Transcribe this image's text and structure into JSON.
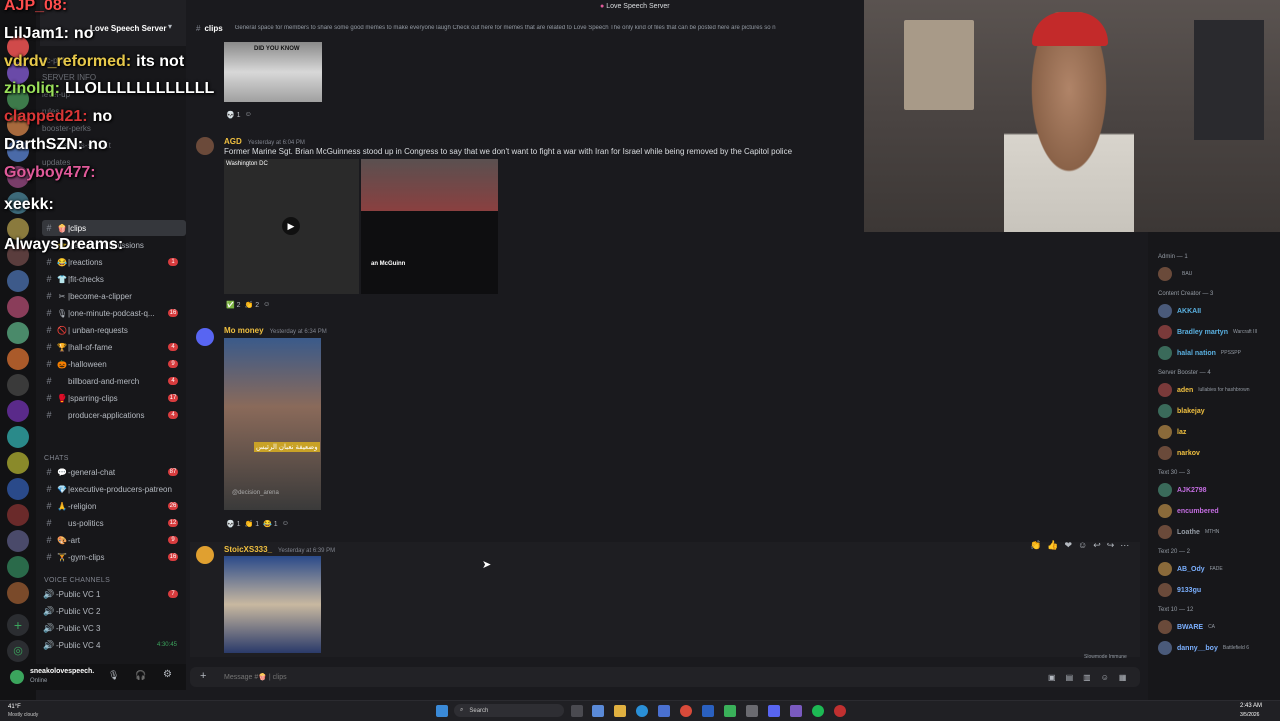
{
  "server": {
    "name": "Love Speech Server",
    "window_title": "Love Speech Server"
  },
  "channel": {
    "name": "clips",
    "topic": "General space for members to share some good memes to make everyone laugh Check out here for memes that are related to Love Speech The only kind of files that can be posted here are pictures so n"
  },
  "overlay_chat": [
    {
      "user": "AJP_08:",
      "msg": "",
      "color": "#ff4d4d"
    },
    {
      "user": "LilJam1:",
      "msg": "no",
      "color": "#ffffff"
    },
    {
      "user": "vdrdv_reformed:",
      "msg": "its not",
      "color": "#e6c84a"
    },
    {
      "user": "zinoliq:",
      "msg": "LLOLLLLLLLLLLLL",
      "color": "#9ae05a"
    },
    {
      "user": "clapped21:",
      "msg": "no",
      "color": "#d93636"
    },
    {
      "user": "DarthSZN:",
      "msg": "no",
      "color": "#ffffff"
    },
    {
      "user": "Goyboy477:",
      "msg": "",
      "color": "#e05a9a"
    },
    {
      "user": "xeekk:",
      "msg": "",
      "color": "#ffffff"
    },
    {
      "user": "AlwaysDreams:",
      "msg": "",
      "color": "#ffffff"
    }
  ],
  "sidebar_partial": [
    "pc-pdf",
    "SERVER INFO",
    "level-up",
    "rules",
    "booster-perks",
    "suggestions-submit",
    "updates"
  ],
  "channels": [
    {
      "name": "|clips",
      "emoji": "🍿",
      "badge": "",
      "active": true
    },
    {
      "name": "|patreon-submissions",
      "emoji": "⭐",
      "badge": "",
      "active": false
    },
    {
      "name": "|reactions",
      "emoji": "😂",
      "badge": "1",
      "active": false
    },
    {
      "name": "|fit-checks",
      "emoji": "👕",
      "badge": "",
      "active": false
    },
    {
      "name": "|become-a-clipper",
      "emoji": "✂",
      "badge": "",
      "active": false
    },
    {
      "name": "|one-minute-podcast-q...",
      "emoji": "🎙",
      "badge": "16",
      "active": false
    },
    {
      "name": "| unban-requests",
      "emoji": "🚫",
      "badge": "",
      "active": false
    },
    {
      "name": "|hall-of-fame",
      "emoji": "🏆",
      "badge": "4",
      "active": false
    },
    {
      "name": "-halloween",
      "emoji": "🎃",
      "badge": "9",
      "active": false
    },
    {
      "name": "billboard-and-merch",
      "emoji": "",
      "badge": "4",
      "active": false
    },
    {
      "name": "|sparring-clips",
      "emoji": "🥊",
      "badge": "17",
      "active": false
    },
    {
      "name": "producer-applications",
      "emoji": "",
      "badge": "4",
      "active": false
    }
  ],
  "chats_category": "CHATS",
  "chat_channels": [
    {
      "name": "-general-chat",
      "emoji": "💬",
      "badge": "87"
    },
    {
      "name": "|executive-producers-patreon",
      "emoji": "💎",
      "badge": ""
    },
    {
      "name": "-religion",
      "emoji": "🙏",
      "badge": "26"
    },
    {
      "name": "us-politics",
      "emoji": "",
      "badge": "12"
    },
    {
      "name": "-art",
      "emoji": "🎨",
      "badge": "9"
    },
    {
      "name": "-gym-clips",
      "emoji": "🏋",
      "badge": "16"
    }
  ],
  "voice_category": "VOICE CHANNELS",
  "voice_channels": [
    {
      "name": "-Public VC 1",
      "badge": "7"
    },
    {
      "name": "-Public VC 2",
      "badge": ""
    },
    {
      "name": "-Public VC 3",
      "badge": ""
    },
    {
      "name": "-Public VC 4",
      "badge": "4:30:45"
    }
  ],
  "user_panel": {
    "name": "sneakolovespeech.",
    "status": "Online"
  },
  "messages": [
    {
      "author": "AGD",
      "time": "Yesterday at 6:04 PM",
      "text": "Former Marine Sgt. Brian McGuinness stood up in Congress to say that we don't want to fight a war with Iran for Israel while being removed by the Capitol police",
      "location": "Washington DC",
      "card_name": "an McGuinn",
      "reactions": [
        "✅ 2",
        "👏 2"
      ]
    },
    {
      "author": "Mo money",
      "time": "Yesterday at 6:34 PM",
      "text": "",
      "caption": "وضعيفة نعبان الرئيس",
      "video_tag": "@decision_arena",
      "reactions": [
        "💀 1",
        "👏 1",
        "😂 1"
      ]
    },
    {
      "author": "StoicXS333_",
      "time": "Yesterday at 6:39 PM",
      "text": "",
      "reactions": []
    }
  ],
  "first_msg": {
    "caption": "DID YOU KNOW",
    "reactions": [
      "💀 1"
    ]
  },
  "composer": {
    "placeholder": "Message #🍿 | clips",
    "slowmode": "Slowmode Immune"
  },
  "members": {
    "groups": [
      {
        "role": "Admin — 1",
        "users": [
          {
            "name": "",
            "tag": "BAU",
            "color": "#dbdee1"
          }
        ]
      },
      {
        "role": "Content Creator — 3",
        "users": [
          {
            "name": "AKKAII",
            "tag": "",
            "color": "#5ab0e0"
          },
          {
            "name": "Bradley martyn",
            "tag": "Warcraft III",
            "color": "#5ab0e0"
          },
          {
            "name": "halal nation",
            "tag": "PPSSPP",
            "color": "#5ab0e0"
          }
        ]
      },
      {
        "role": "Server Booster — 4",
        "users": [
          {
            "name": "aden",
            "tag": "lullabies for hashbrown",
            "color": "#f0c040"
          },
          {
            "name": "blakejay",
            "tag": "",
            "color": "#f0c040"
          },
          {
            "name": "laz",
            "tag": "",
            "color": "#f0c040"
          },
          {
            "name": "narkov",
            "tag": "",
            "color": "#f0c040"
          }
        ]
      },
      {
        "role": "Text 30 — 3",
        "users": [
          {
            "name": "AJK2798",
            "tag": "",
            "color": "#c36de0"
          },
          {
            "name": "encumbered",
            "tag": "",
            "color": "#c36de0"
          },
          {
            "name": "Loathe",
            "tag": "MTHN",
            "color": "#949ba4"
          }
        ]
      },
      {
        "role": "Text 20 — 2",
        "users": [
          {
            "name": "AB_Ody",
            "tag": "FADE",
            "color": "#7bb0ff"
          },
          {
            "name": "9133gu",
            "tag": "",
            "color": "#7bb0ff"
          }
        ]
      },
      {
        "role": "Text 10 — 12",
        "users": [
          {
            "name": "BWARE",
            "tag": "CA",
            "color": "#7bb0ff"
          },
          {
            "name": "danny__boy",
            "tag": "Battlefield 6",
            "color": "#7bb0ff"
          }
        ]
      }
    ]
  },
  "taskbar": {
    "weather": "41°F",
    "weather_desc": "Mostly cloudy",
    "search": "Search",
    "time": "2:43 AM",
    "date": "3/5/2026"
  },
  "colors": {
    "accent": "#5865f2",
    "red_badge": "#d83c3e",
    "bg": "#1a1a1e"
  }
}
